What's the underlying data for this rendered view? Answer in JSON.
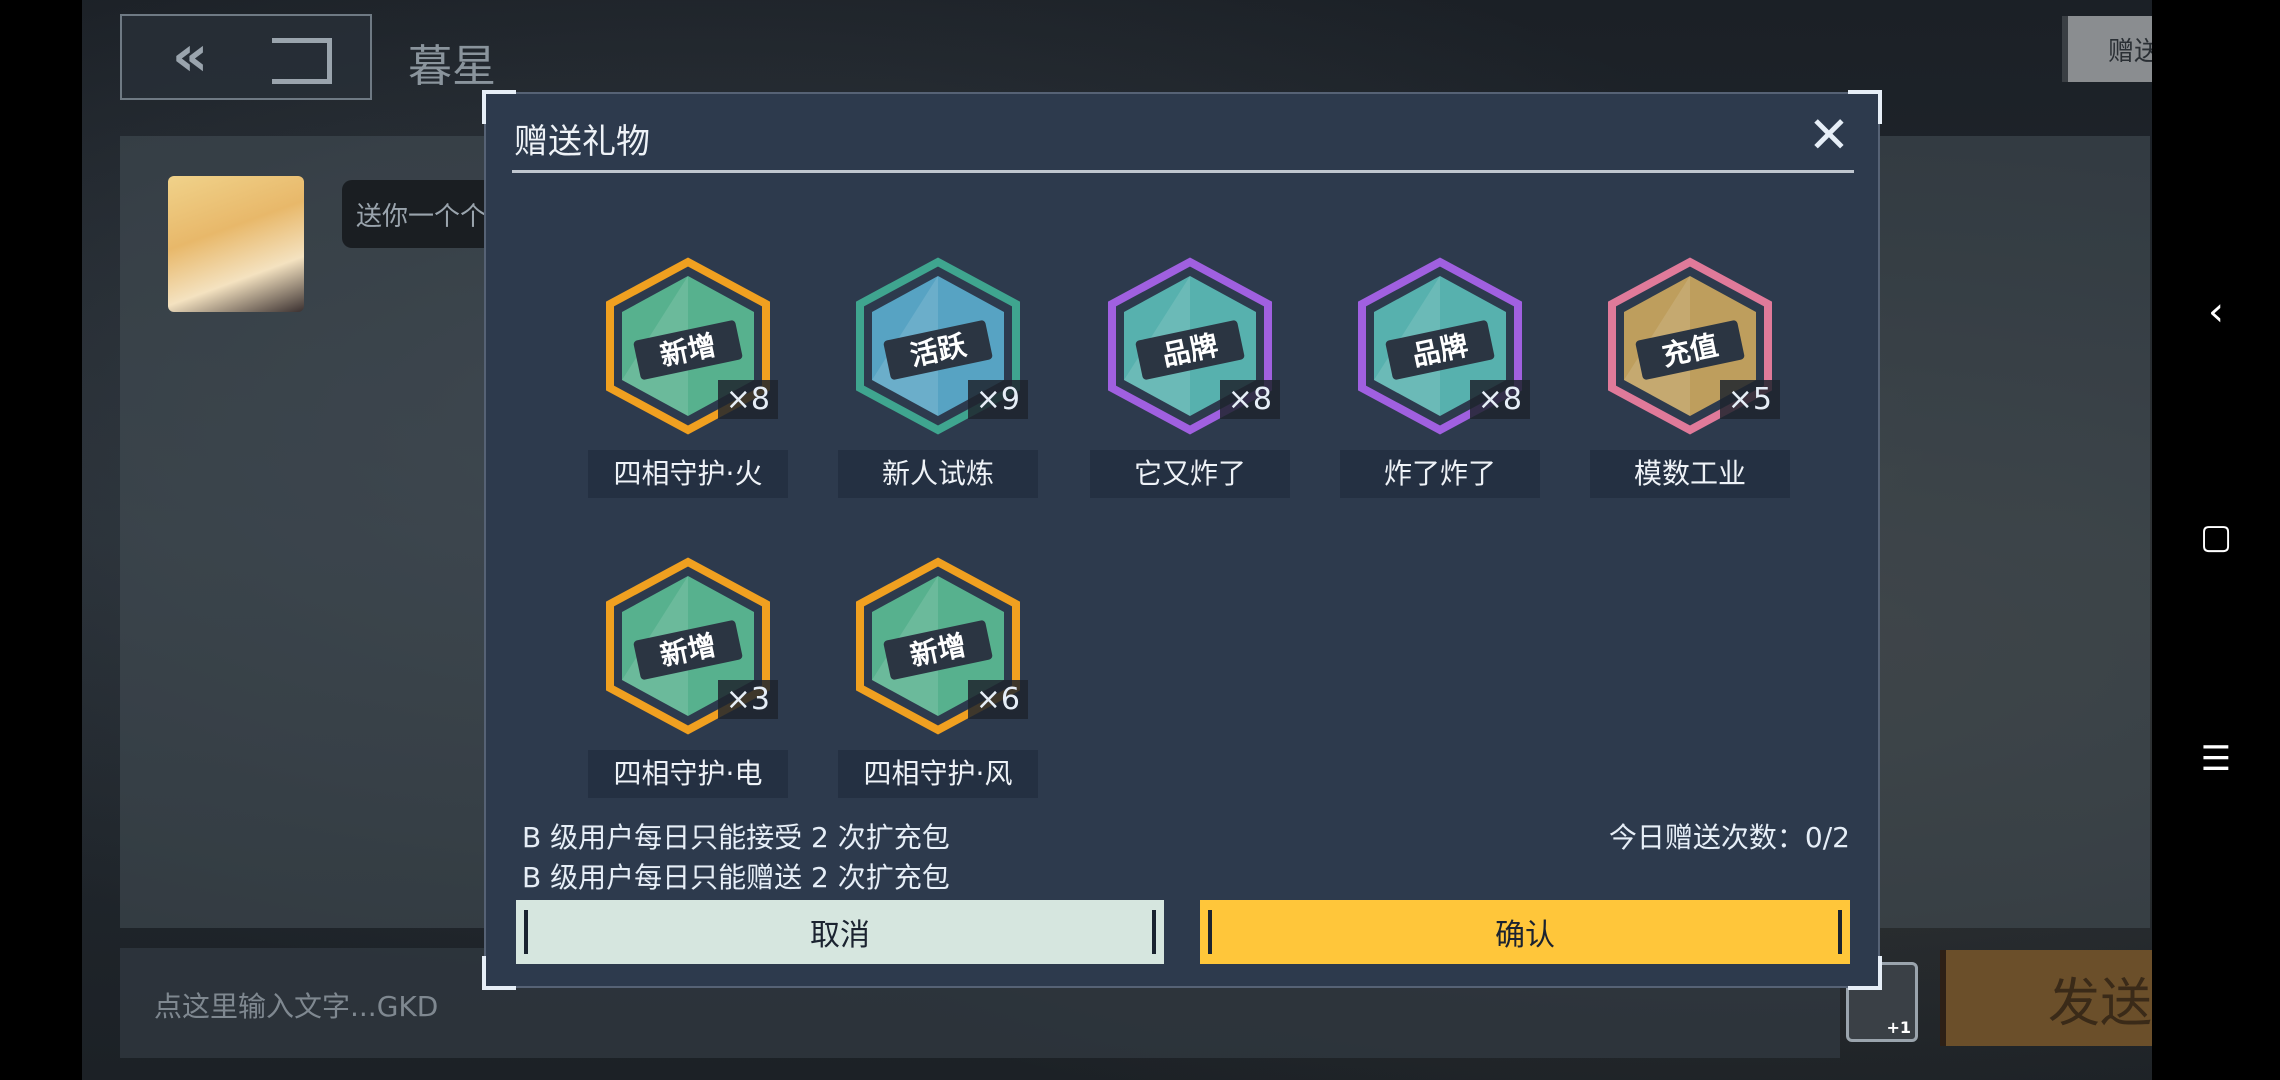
{
  "header": {
    "title": "暮星",
    "gift_button": "赠送礼物"
  },
  "chat": {
    "bubble_text": "送你一个个",
    "input_placeholder": "点这里输入文字...GKD",
    "send_button": "发送",
    "gamepad_badge": "+1"
  },
  "dialog": {
    "title": "赠送礼物",
    "gifts": [
      {
        "name": "四相守护·火",
        "count": "×8",
        "tag": "新增",
        "frame_color": "#f0a020",
        "fill": "#5fc79a"
      },
      {
        "name": "新人试炼",
        "count": "×9",
        "tag": "活跃",
        "frame_color": "#3fa58f",
        "fill": "#5fb6d8"
      },
      {
        "name": "它又炸了",
        "count": "×8",
        "tag": "品牌",
        "frame_color": "#a060e0",
        "fill": "#5fc7c0"
      },
      {
        "name": "炸了炸了",
        "count": "×8",
        "tag": "品牌",
        "frame_color": "#a060e0",
        "fill": "#5fc7c0"
      },
      {
        "name": "模数工业",
        "count": "×5",
        "tag": "充值",
        "frame_color": "#e07a9a",
        "fill": "#d8b060"
      },
      {
        "name": "四相守护·电",
        "count": "×3",
        "tag": "新增",
        "frame_color": "#f0a020",
        "fill": "#5fc79a"
      },
      {
        "name": "四相守护·风",
        "count": "×6",
        "tag": "新增",
        "frame_color": "#f0a020",
        "fill": "#5fc79a"
      }
    ],
    "note_receive": "B 级用户每日只能接受 2 次扩充包",
    "note_send": "B 级用户每日只能赠送 2 次扩充包",
    "today_count": "今日赠送次数：0/2",
    "cancel": "取消",
    "confirm": "确认"
  }
}
